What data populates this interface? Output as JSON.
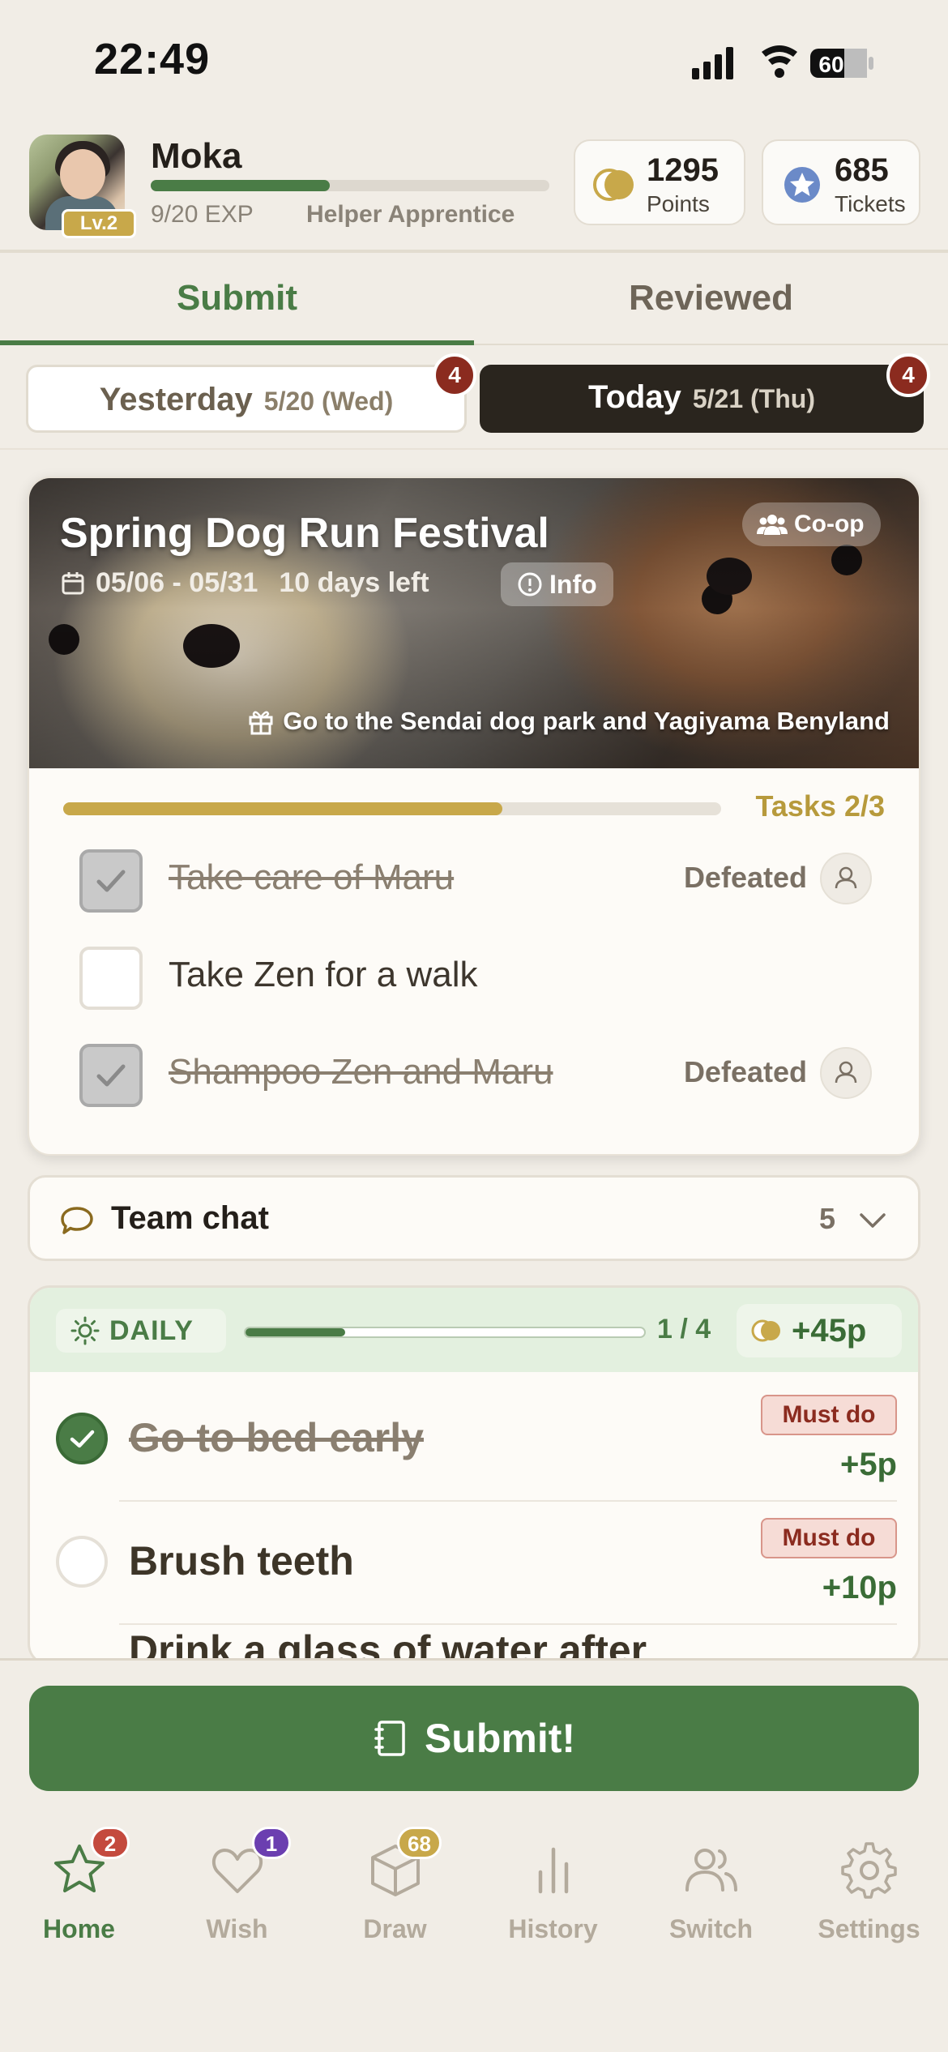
{
  "status_bar": {
    "time": "22:49",
    "battery": "60"
  },
  "profile": {
    "name": "Moka",
    "level": "Lv.2",
    "exp_text": "9/20 EXP",
    "exp_fraction": 0.45,
    "rank": "Helper Apprentice"
  },
  "stats": {
    "points": {
      "value": "1295",
      "label": "Points",
      "icon": "coin-icon"
    },
    "tickets": {
      "value": "685",
      "label": "Tickets",
      "icon": "star-ticket-icon"
    }
  },
  "tabs": [
    {
      "label": "Submit",
      "active": true
    },
    {
      "label": "Reviewed",
      "active": false
    }
  ],
  "days": [
    {
      "label": "Yesterday",
      "date": "5/20 (Wed)",
      "badge": "4",
      "active": false
    },
    {
      "label": "Today",
      "date": "5/21 (Thu)",
      "badge": "4",
      "active": true
    }
  ],
  "event": {
    "title": "Spring Dog Run Festival",
    "mode": "Co-op",
    "dates": "05/06 - 05/31",
    "days_left": "10 days left",
    "info_label": "Info",
    "reward": "Go to the Sendai dog park and Yagiyama Benyland",
    "progress_fraction": 0.667,
    "tasks_label": "Tasks 2/3",
    "tasks": [
      {
        "label": "Take care of Maru",
        "done": true,
        "status": "Defeated"
      },
      {
        "label": "Take Zen for a walk",
        "done": false,
        "status": ""
      },
      {
        "label": "Shampoo Zen and Maru",
        "done": true,
        "status": "Defeated"
      }
    ]
  },
  "team_chat": {
    "label": "Team chat",
    "count": "5"
  },
  "daily": {
    "label": "DAILY",
    "progress_text": "1 / 4",
    "progress_fraction": 0.25,
    "points": "+45p",
    "tasks": [
      {
        "label": "Go to bed early",
        "done": true,
        "badge": "Must do",
        "points": "+5p"
      },
      {
        "label": "Brush teeth",
        "done": false,
        "badge": "Must do",
        "points": "+10p"
      },
      {
        "label": "Drink a glass of water after",
        "done": false,
        "badge": "",
        "points": ""
      }
    ]
  },
  "submit": {
    "label": "Submit!"
  },
  "nav": [
    {
      "label": "Home",
      "icon": "star-icon",
      "badge": "2",
      "badge_color": "#c44a3e",
      "active": true
    },
    {
      "label": "Wish",
      "icon": "heart-icon",
      "badge": "1",
      "badge_color": "#6b3fb0",
      "active": false
    },
    {
      "label": "Draw",
      "icon": "box-icon",
      "badge": "68",
      "badge_color": "#c8a84a",
      "active": false
    },
    {
      "label": "History",
      "icon": "bar-chart-icon",
      "badge": "",
      "badge_color": "",
      "active": false
    },
    {
      "label": "Switch",
      "icon": "users-icon",
      "badge": "",
      "badge_color": "",
      "active": false
    },
    {
      "label": "Settings",
      "icon": "gear-icon",
      "badge": "",
      "badge_color": "",
      "active": false
    }
  ],
  "colors": {
    "accent_green": "#4a7c46",
    "gold": "#c8a84a",
    "alert_red": "#8b2b1f",
    "background": "#f1ede6"
  }
}
